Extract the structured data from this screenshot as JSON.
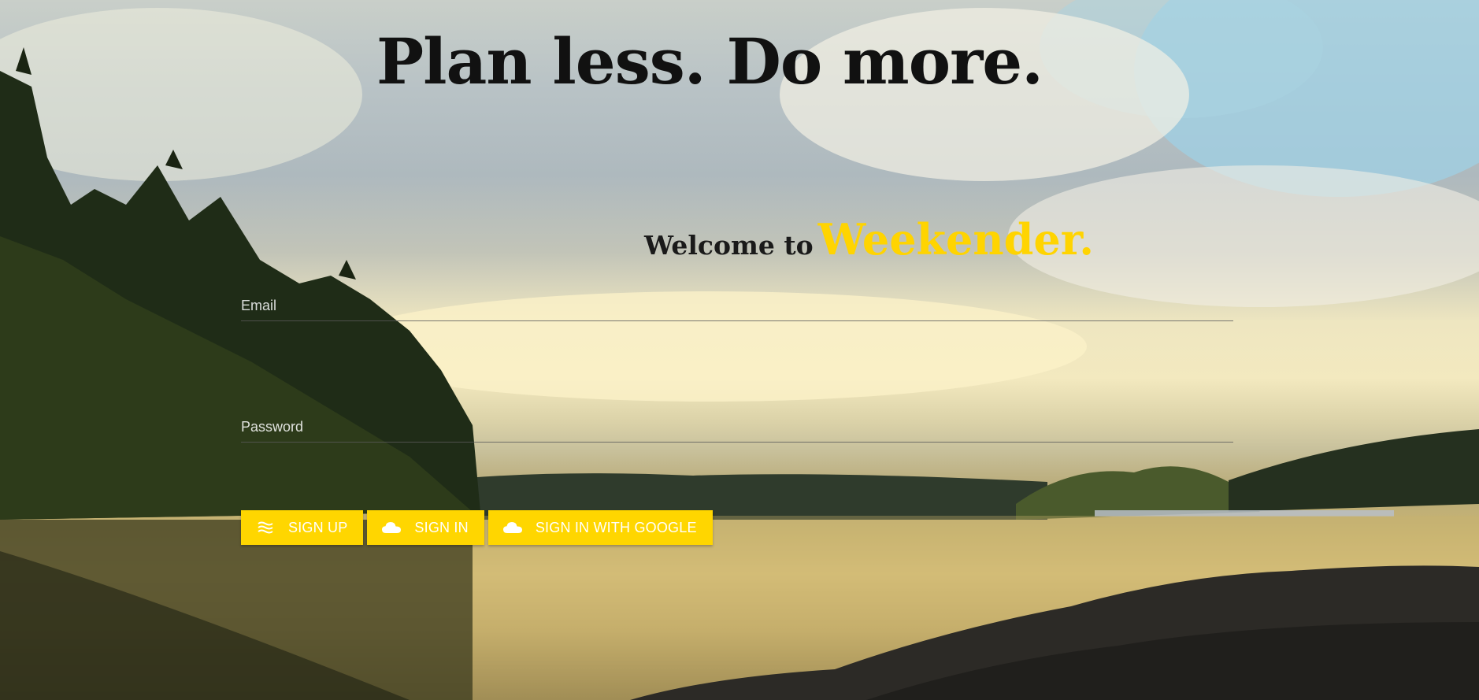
{
  "hero": {
    "headline": "Plan less. Do more.",
    "welcome_prefix": "Welcome to",
    "brand_name": "Weekender."
  },
  "form": {
    "email_placeholder": "Email",
    "password_placeholder": "Password"
  },
  "buttons": [
    {
      "label": "SIGN UP",
      "icon": "waves-icon"
    },
    {
      "label": "SIGN IN",
      "icon": "cloud-icon"
    },
    {
      "label": "SIGN IN WITH GOOGLE",
      "icon": "cloud-icon"
    }
  ],
  "colors": {
    "accent": "#ffd600",
    "brand_text": "#ffd400",
    "headline": "#111111",
    "button_text": "#ffffff"
  }
}
